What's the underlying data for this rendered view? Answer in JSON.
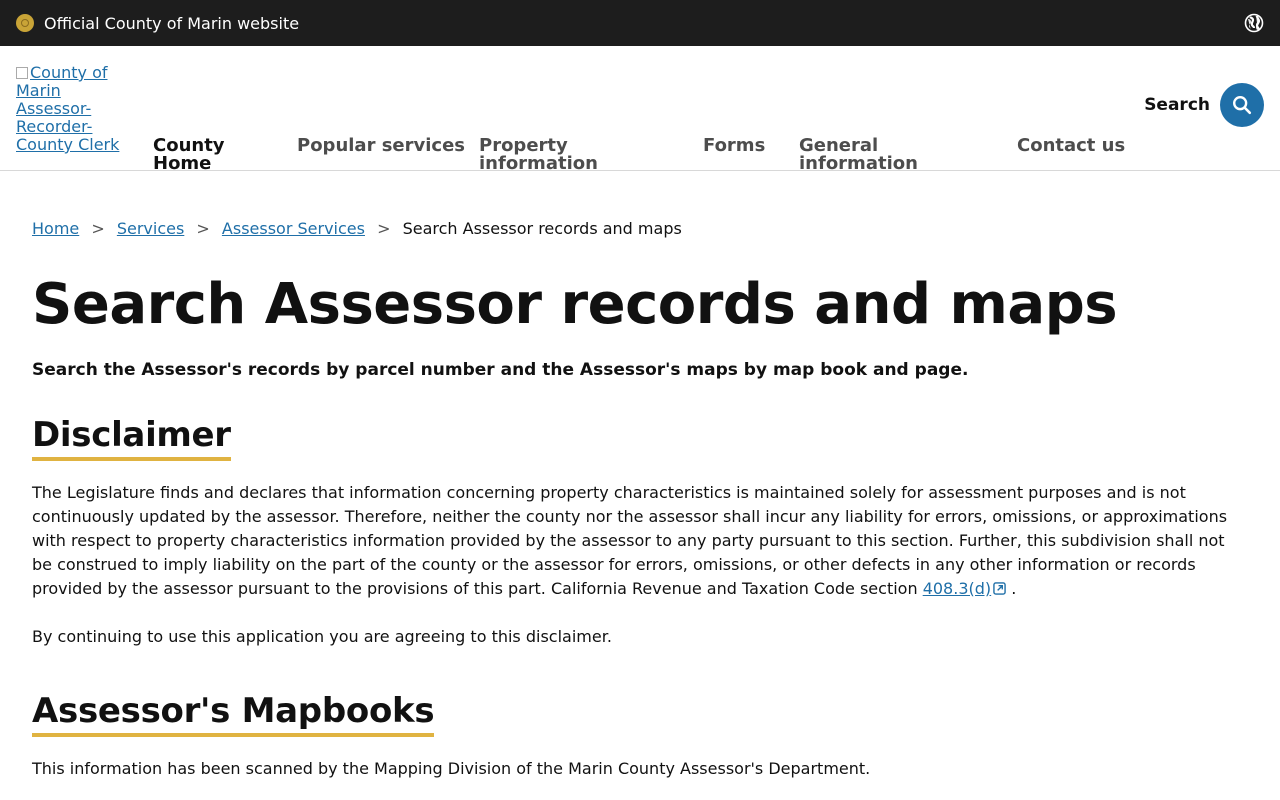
{
  "topbar": {
    "official_text": "Official County of Marin website",
    "seal_icon": "county-seal-icon",
    "globe_icon": "globe-icon"
  },
  "header": {
    "logo_alt": "County of Marin Assessor-Recorder-County Clerk",
    "nav": [
      {
        "line1": "County",
        "line2": "Home"
      },
      {
        "line1": "Popular services",
        "line2": ""
      },
      {
        "line1": "Property",
        "line2": "information"
      },
      {
        "line1": "Forms",
        "line2": ""
      },
      {
        "line1": "General",
        "line2": "information"
      },
      {
        "line1": "Contact us",
        "line2": ""
      }
    ],
    "search_label": "Search",
    "search_icon": "search-icon",
    "accent": "#1f6fa8"
  },
  "breadcrumb": {
    "items": [
      "Home",
      "Services",
      "Assessor Services"
    ],
    "current": "Search Assessor records and maps",
    "separator": ">"
  },
  "page": {
    "title": "Search Assessor records and maps",
    "subtitle": "Search the Assessor's records by parcel number and the Assessor's maps by map book and page."
  },
  "disclaimer": {
    "heading": "Disclaimer",
    "body": "The Legislature finds and declares that information concerning property characteristics is maintained solely for assessment purposes and is not continuously updated by the assessor. Therefore, neither the county nor the assessor shall incur any liability for errors, omissions, or approximations with respect to property characteristics information provided by the assessor to any party pursuant to this section. Further, this subdivision shall not be construed to imply liability on the part of the county or the assessor for errors, omissions, or other defects in any other information or records provided by the assessor pursuant to the provisions of this part. California Revenue and Taxation Code section",
    "link_text": "408.3(d)",
    "after_link": ".",
    "agree_text": "By continuing to use this application you are agreeing to this disclaimer."
  },
  "mapbooks": {
    "heading": "Assessor's Mapbooks",
    "body": "This information has been scanned by the Mapping Division of the Marin County Assessor's Department."
  },
  "colors": {
    "topbar_bg": "#1d1d1d",
    "heading_underline": "#e0b341",
    "link": "#1f6fa8"
  }
}
